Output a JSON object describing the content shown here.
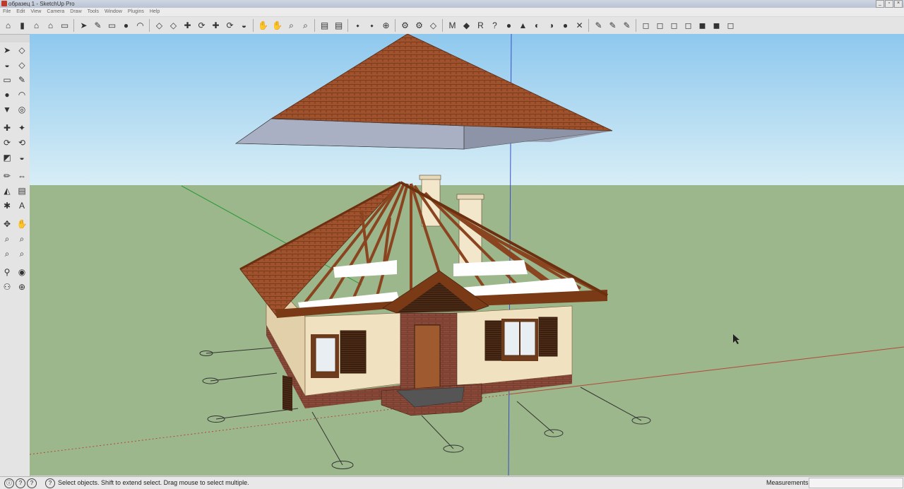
{
  "window": {
    "title": "образец 1 - SketchUp Pro",
    "minimize": "_",
    "maximize": "▫",
    "close": "×"
  },
  "menu": [
    "File",
    "Edit",
    "View",
    "Camera",
    "Draw",
    "Tools",
    "Window",
    "Plugins",
    "Help"
  ],
  "toolbar": {
    "groups": [
      [
        "⌂",
        "▮",
        "⌂",
        "⌂",
        "▭"
      ],
      [
        "➤",
        "✎",
        "▭",
        "●",
        "◠"
      ],
      [
        "◇",
        "◇",
        "✚",
        "⟳",
        "✚",
        "⟳",
        "◒"
      ],
      [
        "✋",
        "✋",
        "⌕",
        "⌕"
      ],
      [
        "▤",
        "▤"
      ],
      [
        "⬩",
        "⬩",
        "⊕"
      ],
      [
        "⚙",
        "⚙",
        "◇"
      ],
      [
        "M",
        "◆",
        "R",
        "?",
        "●",
        "▲",
        "◐",
        "◑",
        "●",
        "✕"
      ],
      [
        "✎",
        "✎",
        "✎"
      ],
      [
        "◻",
        "◻",
        "◻",
        "◻",
        "◼",
        "◼",
        "◻"
      ]
    ]
  },
  "left_tools": [
    [
      "➤",
      "◇"
    ],
    [
      "◒",
      "◇"
    ],
    [
      "▭",
      "✎"
    ],
    [
      "●",
      "◠"
    ],
    [
      "▼",
      "◎"
    ],
    [
      "✚",
      "✦"
    ],
    [
      "⟳",
      "⟲"
    ],
    [
      "◩",
      "◒"
    ],
    [
      "✏",
      "⇔"
    ],
    [
      "◭",
      "▤"
    ],
    [
      "✱",
      "A"
    ],
    [
      "✥",
      "✋"
    ],
    [
      "⌕",
      "⌕"
    ],
    [
      "⌕",
      "⌕"
    ],
    [
      "⚲",
      "◉"
    ],
    [
      "⚇",
      "⊕"
    ]
  ],
  "status": {
    "hint": "Select objects. Shift to extend select. Drag mouse to select multiple.",
    "measurements_label": "Measurements",
    "measurements_value": "",
    "buttons": [
      "ⓘ",
      "?",
      "?"
    ]
  },
  "colors": {
    "sky_top": "#8ec8ee",
    "sky_bottom": "#d8eef6",
    "ground": "#9cb78c",
    "roof": "#a0522d",
    "wall": "#f0e2c0",
    "brick": "#8b4a3a"
  }
}
